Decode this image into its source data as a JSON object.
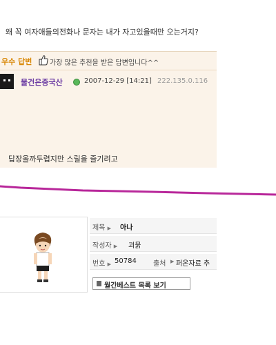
{
  "question": {
    "text": "왜 꼭 여자애들의전화나 문자는 내가 자고있을때만 오는거지?"
  },
  "best_answer": {
    "badge": "우수 답변",
    "description": "가장 많은 추천을 받은 답변입니다^^",
    "user": {
      "name": "물건은중국산",
      "datetime": "2007-12-29 [14:21]",
      "ip": "222.135.0.116"
    },
    "body": "답장올까두렵지만 스릴을 즐기려고"
  },
  "post": {
    "title_label": "제목",
    "title_value": "아나",
    "author_label": "작성자",
    "author_value": "괴묽",
    "number_label": "번호",
    "number_value": "50784",
    "source_label": "출처",
    "source_value": "퍼온자료 추",
    "list_button": "월간베스트 목록 보기"
  },
  "colors": {
    "accent_orange": "#d98a0a",
    "username_purple": "#6a3aa2",
    "divider_magenta": "#b8279a",
    "panel_bg": "#fbf3e9"
  }
}
